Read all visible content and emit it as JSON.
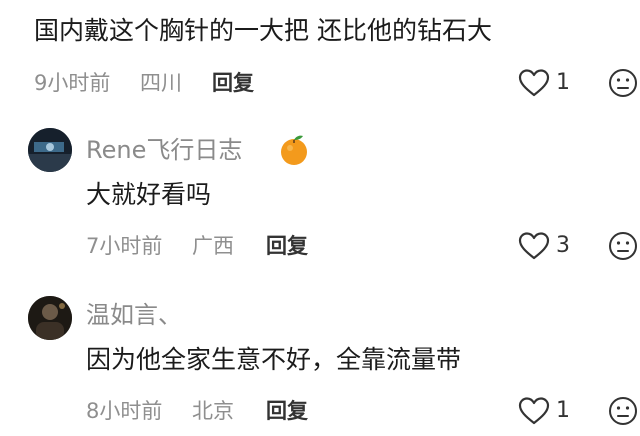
{
  "comments": [
    {
      "text": "国内戴这个胸针的一大把 还比他的钻石大",
      "time": "9小时前",
      "location": "四川",
      "reply_label": "回复",
      "likes": "1"
    },
    {
      "username": "Rene飞行日志",
      "badge_icon": "orange-fruit-icon",
      "text": "大就好看吗",
      "time": "7小时前",
      "location": "广西",
      "reply_label": "回复",
      "likes": "3"
    },
    {
      "username": "温如言、",
      "text": "因为他全家生意不好，全靠流量带",
      "time": "8小时前",
      "location": "北京",
      "reply_label": "回复",
      "likes": "1"
    }
  ],
  "icons": {
    "like": "heart-outline-icon",
    "dislike": "neutral-face-icon"
  },
  "colors": {
    "accent_orange": "#f39a1c",
    "meta_gray": "#8f8f8f"
  }
}
